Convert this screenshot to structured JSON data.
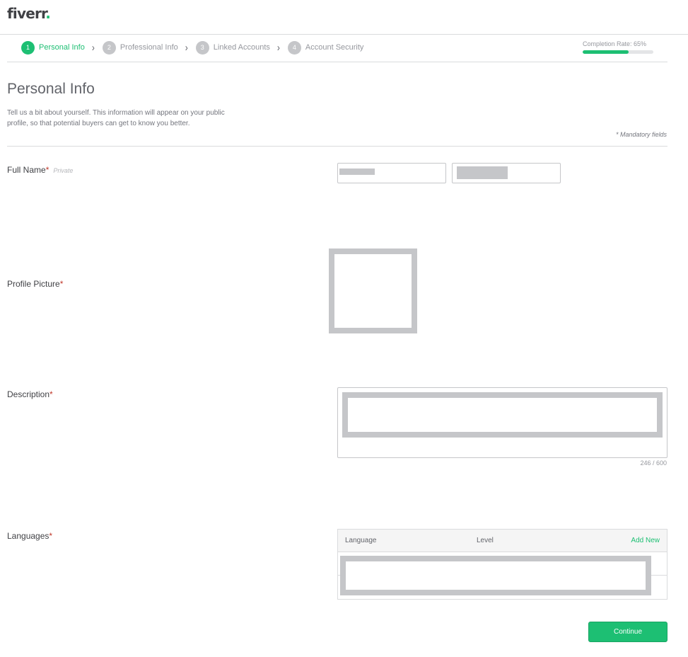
{
  "header": {
    "logo_text": "fiverr",
    "logo_dot": "."
  },
  "steps": [
    {
      "number": "1",
      "label": "Personal Info",
      "active": true
    },
    {
      "number": "2",
      "label": "Professional Info",
      "active": false
    },
    {
      "number": "3",
      "label": "Linked Accounts",
      "active": false
    },
    {
      "number": "4",
      "label": "Account Security",
      "active": false
    }
  ],
  "step_separator": "›",
  "completion": {
    "label": "Completion Rate: 65%",
    "percent": 65
  },
  "page": {
    "title": "Personal Info",
    "description": "Tell us a bit about yourself. This information will appear on your public profile, so that potential buyers can get to know you better.",
    "mandatory_note": "* Mandatory fields"
  },
  "fields": {
    "full_name": {
      "label": "Full Name",
      "required_mark": "*",
      "privacy": "Private"
    },
    "profile_picture": {
      "label": "Profile Picture",
      "required_mark": "*"
    },
    "description": {
      "label": "Description",
      "required_mark": "*",
      "char_count": "246 / 600"
    },
    "languages": {
      "label": "Languages",
      "required_mark": "*",
      "col_language": "Language",
      "col_level": "Level",
      "add_new": "Add New"
    }
  },
  "actions": {
    "continue_label": "Continue"
  },
  "colors": {
    "brand_green": "#1dbf73",
    "redaction_gray": "#c5c6c9",
    "required_red": "#c0392b"
  }
}
